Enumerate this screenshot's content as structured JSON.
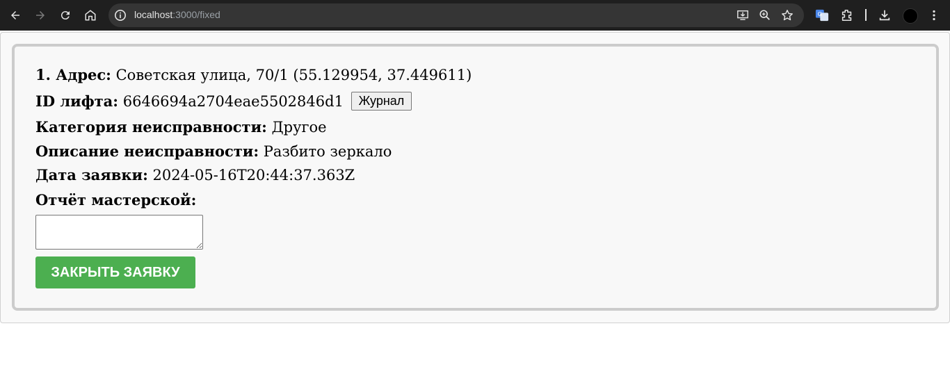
{
  "browser": {
    "url_host": "localhost",
    "url_path": ":3000/fixed"
  },
  "order": {
    "address_label": "1. Адрес:",
    "address_value": "Советская улица, 70/1 (55.129954, 37.449611)",
    "lift_id_label": "ID лифта:",
    "lift_id_value": "6646694a2704eae5502846d1",
    "journal_button": "Журнал",
    "category_label": "Категория неисправности:",
    "category_value": "Другое",
    "description_label": "Описание неисправности:",
    "description_value": "Разбито зеркало",
    "date_label": "Дата заявки:",
    "date_value": "2024-05-16T20:44:37.363Z",
    "report_label": "Отчёт мастерской:",
    "report_value": "",
    "close_button": "ЗАКРЫТЬ ЗАЯВКУ"
  },
  "colors": {
    "close_button_bg": "#4caf50",
    "card_border": "#cccccc",
    "chrome_bg": "#1f1f1f"
  },
  "icons": [
    "back-icon",
    "forward-icon",
    "reload-icon",
    "home-icon",
    "site-info-icon",
    "install-app-icon",
    "zoom-icon",
    "bookmark-star-icon",
    "translate-icon",
    "extensions-icon",
    "downloads-icon",
    "profile-avatar",
    "menu-icon"
  ]
}
